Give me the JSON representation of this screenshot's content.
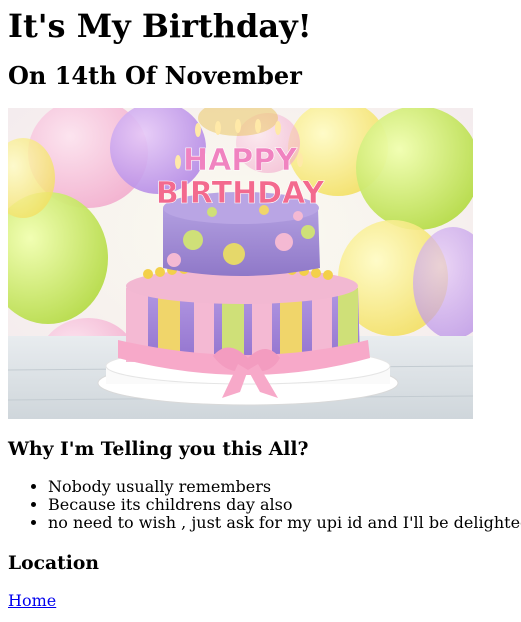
{
  "page": {
    "title": "It's My Birthday!",
    "subtitle": "On 14th Of November",
    "image_alt": "Birthday cake with Happy Birthday candles",
    "cake_text": {
      "happy": "HAPPY",
      "birthday": "BIRTHDAY"
    },
    "why_heading": "Why I'm Telling you this All?",
    "reasons": [
      "Nobody usually remembers",
      "Because its childrens day also",
      "no need to wish , just ask for my upi id and I'll be delighted"
    ],
    "location_heading": "Location",
    "home_link": "Home"
  },
  "colors": {
    "link": "#0000ee",
    "text": "#000000",
    "background": "#ffffff"
  }
}
